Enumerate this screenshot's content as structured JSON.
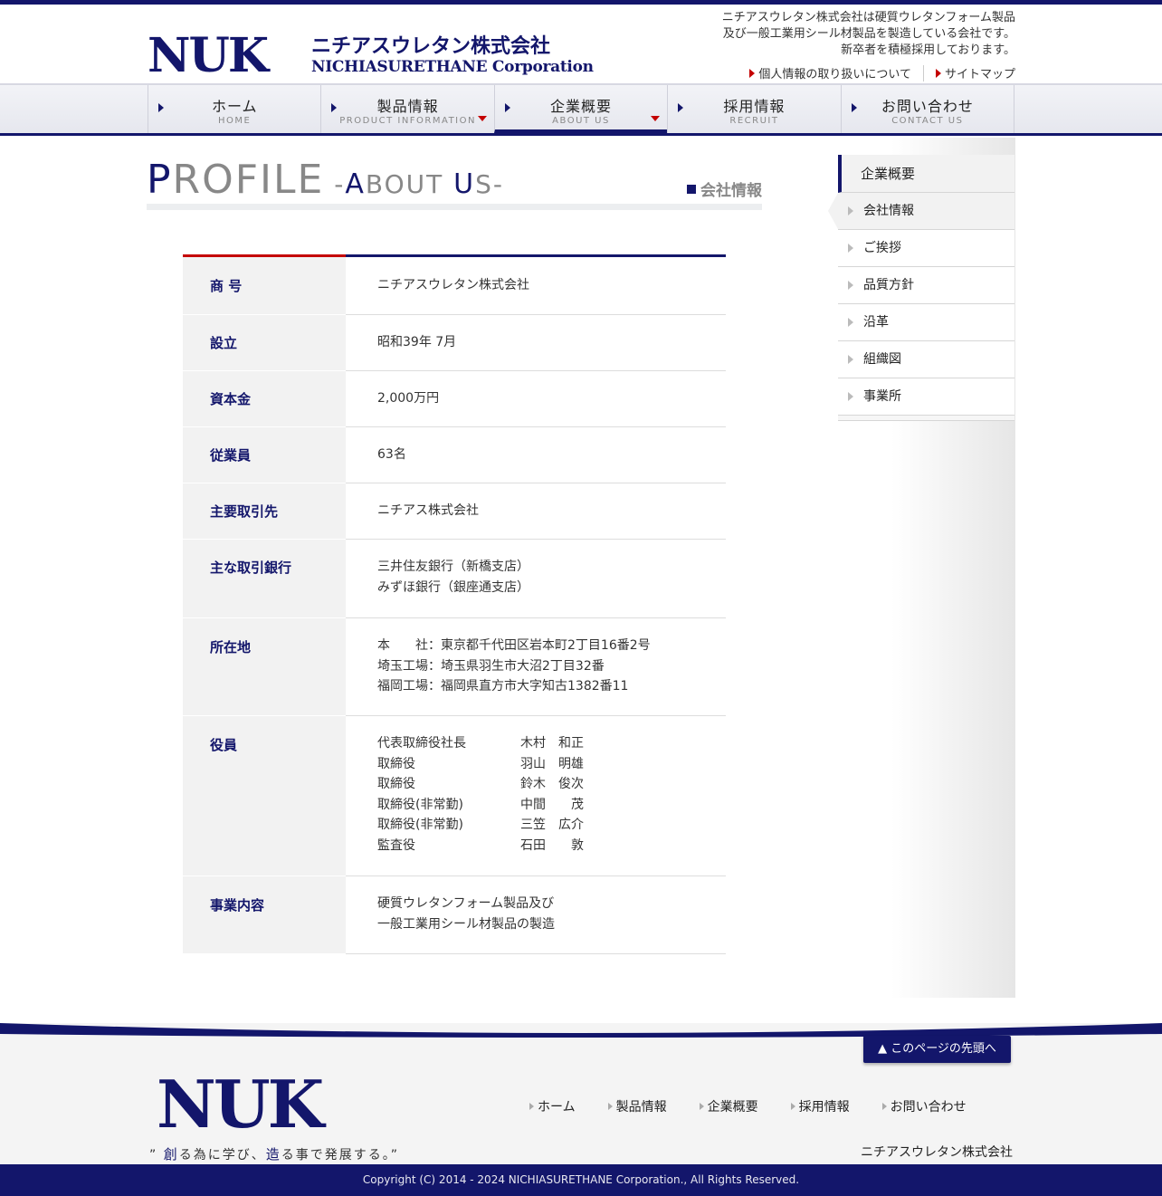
{
  "header": {
    "logo_mark": "NUK",
    "logo_jp": "ニチアスウレタン株式会社",
    "logo_en": "NICHIASURETHANE Corporation",
    "tagline": [
      "ニチアスウレタン株式会社は硬質ウレタンフォーム製品",
      "及び一般工業用シール材製品を製造している会社です。",
      "新卒者を積極採用しております。"
    ],
    "links": {
      "privacy": "個人情報の取り扱いについて",
      "sitemap": "サイトマップ"
    }
  },
  "gnav": [
    {
      "jp": "ホーム",
      "en": "HOME"
    },
    {
      "jp": "製品情報",
      "en": "PRODUCT INFORMATION"
    },
    {
      "jp": "企業概要",
      "en": "ABOUT US"
    },
    {
      "jp": "採用情報",
      "en": "RECRUIT"
    },
    {
      "jp": "お問い合わせ",
      "en": "CONTACT US"
    }
  ],
  "page_title": {
    "p": "P",
    "rofile": "ROFILE",
    "dash1": " -",
    "a": "A",
    "bout": "BOUT ",
    "u": "U",
    "s": "S-",
    "jp": "会社情報"
  },
  "profile": {
    "rows": [
      {
        "label": "商 号",
        "lines": [
          "ニチアスウレタン株式会社"
        ]
      },
      {
        "label": "設立",
        "lines": [
          "昭和39年 7月"
        ]
      },
      {
        "label": "資本金",
        "lines": [
          "2,000万円"
        ]
      },
      {
        "label": "従業員",
        "lines": [
          "63名"
        ]
      },
      {
        "label": "主要取引先",
        "lines": [
          "ニチアス株式会社"
        ]
      },
      {
        "label": "主な取引銀行",
        "lines": [
          "三井住友銀行（新橋支店）",
          "みずほ銀行（銀座通支店）"
        ]
      },
      {
        "label": "所在地",
        "lines": [
          "本　　社：東京都千代田区岩本町2丁目16番2号",
          "埼玉工場：埼玉県羽生市大沼2丁目32番",
          "福岡工場：福岡県直方市大字知古1382番11"
        ]
      },
      {
        "label": "役員",
        "officers": [
          {
            "role": "代表取締役社長",
            "name": "木村　和正"
          },
          {
            "role": "取締役",
            "name": "羽山　明雄"
          },
          {
            "role": "取締役",
            "name": "鈴木　俊次"
          },
          {
            "role": "取締役(非常勤)",
            "name": "中間　　茂"
          },
          {
            "role": "取締役(非常勤)",
            "name": "三笠　広介"
          },
          {
            "role": "監査役",
            "name": "石田　　敦"
          }
        ]
      },
      {
        "label": "事業内容",
        "lines": [
          "硬質ウレタンフォーム製品及び",
          "一般工業用シール材製品の製造"
        ]
      }
    ]
  },
  "sidenav": {
    "title": "企業概要",
    "items": [
      "会社情報",
      "ご挨拶",
      "品質方針",
      "沿革",
      "組織図",
      "事業所"
    ]
  },
  "footer": {
    "pagetop": "▲ このページの先頭へ",
    "logo": "NUK",
    "slogan": {
      "q1": "” ",
      "c1": "創",
      "t1": "る為に学び、",
      "c2": "造",
      "t2": "る事で発展する。",
      "q2": "”"
    },
    "nav": [
      "ホーム",
      "製品情報",
      "企業概要",
      "採用情報",
      "お問い合わせ"
    ],
    "company": "ニチアスウレタン株式会社",
    "copyright": "Copyright (C) 2014 - 2024 NICHIASURETHANE Corporation., All Rights Reserved."
  },
  "colors": {
    "navy": "#13166b",
    "red": "#c40000",
    "gray_bg": "#f2f2f2"
  }
}
